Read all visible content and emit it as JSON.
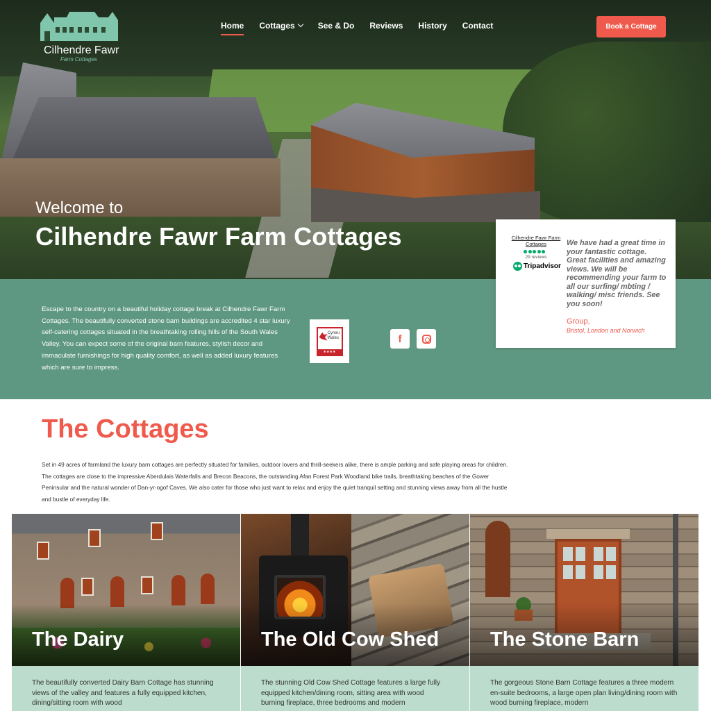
{
  "header": {
    "logo_name": "Cilhendre Fawr",
    "logo_sub": "Farm Cottages",
    "nav": [
      {
        "label": "Home",
        "active": true
      },
      {
        "label": "Cottages",
        "has_dropdown": true
      },
      {
        "label": "See & Do"
      },
      {
        "label": "Reviews"
      },
      {
        "label": "History"
      },
      {
        "label": "Contact"
      }
    ],
    "book_button": "Book a Cottage"
  },
  "hero": {
    "welcome": "Welcome to",
    "title": "Cilhendre Fawr Farm Cottages"
  },
  "intro": {
    "text": "Escape to the country on a beautiful holiday cottage break at Cilhendre Fawr Farm Cottages. The beautifully converted stone barn buildings are accredited 4 star luxury self-catering cottages situated in the breathtaking rolling hills of the South Wales Valley.  You can expect some of the original barn features, stylish decor and immaculate furnishings for high quality comfort, as well as added luxury features which are sure to impress.",
    "badge_text": "Cymru Wales",
    "badge_stars": "★★★★"
  },
  "review": {
    "business_name": "Cilhendre Fawr Farm Cottages",
    "review_count": "29 reviews",
    "rating": 5,
    "provider": "Tripadvisor",
    "quote": "We have had a great time in your fantastic cottage. Great facilities and amazing views. We will be recommending your farm to all our surfing/ mbting / walking/ misc friends. See you soon!",
    "author": "Group,",
    "location": "Bristol, London and Norwich"
  },
  "cottages_section": {
    "title": "The Cottages",
    "body": "Set in 49 acres of farmland the luxury barn cottages are perfectly situated for families, outdoor lovers and thrill-seekers alike, there is ample parking and safe playing areas for children. The cottages are close to the impressive Aberdulais Waterfalls and Brecon Beacons, the outstanding Afan Forest Park Woodland bike trails, breathtaking beaches of the Gower Peninsular and the natural wonder of Dan-yr-ogof Caves. We also cater for those who just want to relax and enjoy the quiet tranquil setting and stunning views away from all the hustle and bustle of everyday life.",
    "cards": [
      {
        "title": "The Dairy",
        "text": "The beautifully converted Dairy Barn Cottage has stunning views of the valley and features a fully equipped kitchen, dining/sitting room with wood"
      },
      {
        "title": "The Old Cow Shed",
        "text": "The stunning Old Cow Shed Cottage features a large fully equipped kitchen/dining room, sitting area with wood burning fireplace, three bedrooms and modern"
      },
      {
        "title": "The Stone Barn",
        "text": "The gorgeous Stone Barn Cottage features a three modern en-suite bedrooms, a large open plan living/dining room with wood burning fireplace, modern"
      }
    ]
  },
  "colors": {
    "accent": "#ef5a4c",
    "band": "#5f9882",
    "card_text_bg": "#bcdccd",
    "logo_green": "#7fc6ad"
  }
}
